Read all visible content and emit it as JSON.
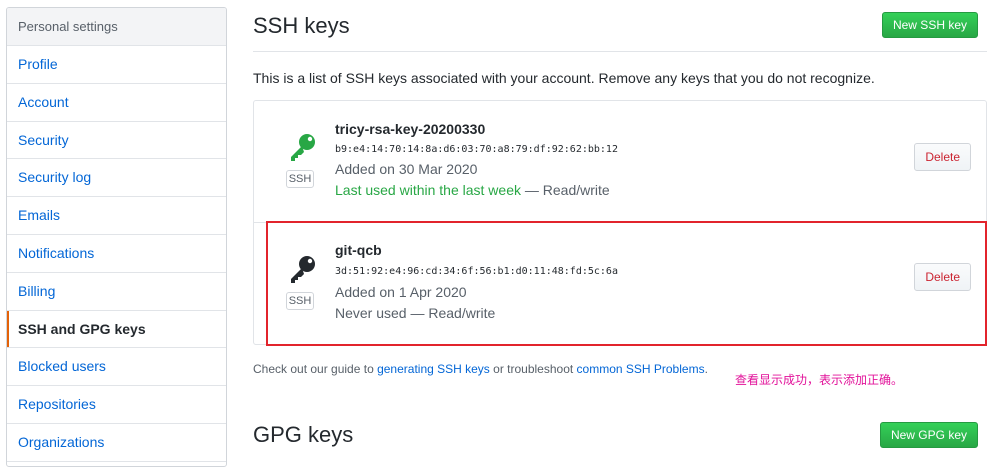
{
  "sidebar": {
    "header": "Personal settings",
    "items": [
      {
        "label": "Profile"
      },
      {
        "label": "Account"
      },
      {
        "label": "Security"
      },
      {
        "label": "Security log"
      },
      {
        "label": "Emails"
      },
      {
        "label": "Notifications"
      },
      {
        "label": "Billing"
      },
      {
        "label": "SSH and GPG keys",
        "selected": true
      },
      {
        "label": "Blocked users"
      },
      {
        "label": "Repositories"
      },
      {
        "label": "Organizations"
      }
    ]
  },
  "ssh": {
    "title": "SSH keys",
    "new_button": "New SSH key",
    "description": "This is a list of SSH keys associated with your account. Remove any keys that you do not recognize.",
    "keys": [
      {
        "title": "tricy-rsa-key-20200330",
        "fingerprint": "b9:e4:14:70:14:8a:d6:03:70:a8:79:df:92:62:bb:12",
        "added": "Added on 30 Mar 2020",
        "used_highlight": "Last used within the last week",
        "used_rest": " — Read/write",
        "badge": "SSH",
        "delete_label": "Delete",
        "icon": "key-icon",
        "icon_color": "#28a745"
      },
      {
        "title": "git-qcb",
        "fingerprint": "3d:51:92:e4:96:cd:34:6f:56:b1:d0:11:48:fd:5c:6a",
        "added": "Added on 1 Apr 2020",
        "used_highlight": "",
        "used_rest": "Never used — Read/write",
        "badge": "SSH",
        "delete_label": "Delete",
        "icon": "key-icon",
        "icon_color": "#24292e"
      }
    ],
    "guide": {
      "before": "Check out our guide to ",
      "link1": "generating SSH keys",
      "middle": " or troubleshoot ",
      "link2": "common SSH Problems",
      "after": "."
    },
    "annotation": "查看显示成功，表示添加正确。"
  },
  "gpg": {
    "title": "GPG keys",
    "new_button": "New GPG key"
  },
  "colors": {
    "accent_green": "#28a745",
    "link_blue": "#0366d6",
    "highlight_red": "#e2242c",
    "annotation_pink": "#e2129a"
  }
}
